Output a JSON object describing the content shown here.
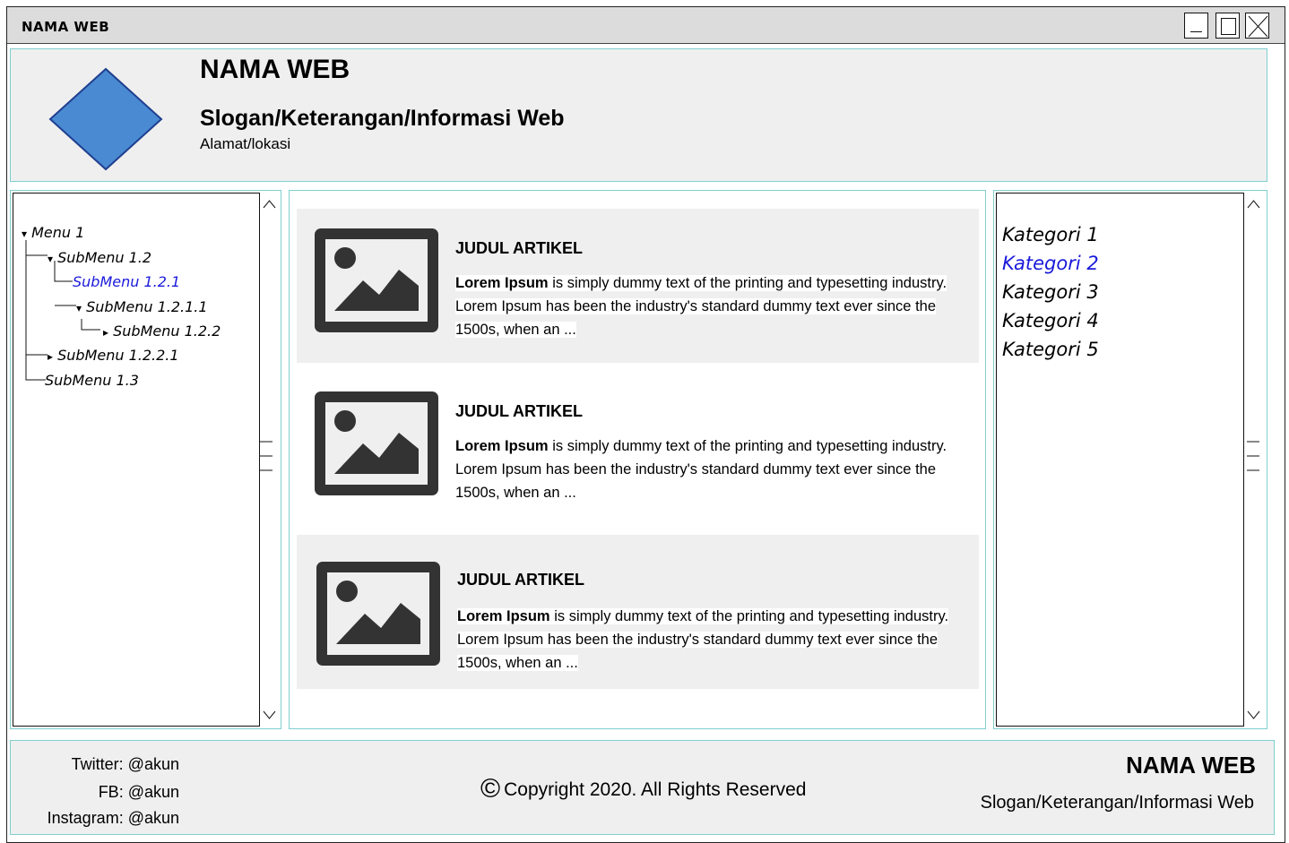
{
  "window": {
    "title": "NAMA WEB"
  },
  "header": {
    "title": "NAMA WEB",
    "slogan": "Slogan/Keterangan/Informasi Web",
    "address": "Alamat/lokasi",
    "logo_icon": "diamond-logo",
    "logo_color": "#4a8ad2"
  },
  "menu": {
    "items": [
      {
        "label": "Menu 1",
        "marker": "▾"
      },
      {
        "label": "SubMenu 1.2",
        "marker": "▾"
      },
      {
        "label": "SubMenu 1.2.1",
        "marker": "",
        "link": true
      },
      {
        "label": "SubMenu 1.2.1.1",
        "marker": "▾"
      },
      {
        "label": "SubMenu 1.2.2",
        "marker": "▸"
      },
      {
        "label": "SubMenu 1.2.2.1",
        "marker": "▸"
      },
      {
        "label": "SubMenu 1.3",
        "marker": ""
      }
    ]
  },
  "articles": [
    {
      "title": "JUDUL ARTIKEL",
      "lead": "Lorem Ipsum",
      "body": " is simply dummy text of the printing and typesetting industry. Lorem Ipsum has been the industry's standard dummy text ever since the 1500s, when an ...",
      "image_icon": "image-placeholder-icon"
    },
    {
      "title": "JUDUL ARTIKEL",
      "lead": "Lorem Ipsum",
      "body": " is simply dummy text of the printing and typesetting industry. Lorem Ipsum has been the industry's standard dummy text ever since the 1500s, when an ...",
      "image_icon": "image-placeholder-icon"
    },
    {
      "title": "JUDUL ARTIKEL",
      "lead": "Lorem Ipsum",
      "body": " is simply dummy text of the printing and typesetting industry. Lorem Ipsum has been the industry's standard dummy text ever since the 1500s, when an ...",
      "image_icon": "image-placeholder-icon"
    }
  ],
  "categories": {
    "items": [
      {
        "label": "Kategori 1"
      },
      {
        "label": "Kategori 2",
        "link": true
      },
      {
        "label": "Kategori 3"
      },
      {
        "label": "Kategori 4"
      },
      {
        "label": "Kategori 5"
      }
    ]
  },
  "footer": {
    "twitter": "Twitter: @akun",
    "fb": "FB: @akun",
    "instagram": "Instagram: @akun",
    "copyright_symbol": "©",
    "copyright": "Copyright  2020. All Rights Reserved",
    "name": "NAMA WEB",
    "slogan": "Slogan/Keterangan/Informasi Web"
  },
  "colors": {
    "panel_bg": "#efefef",
    "panel_border": "#7fcfcf",
    "link": "#1a1adb"
  }
}
